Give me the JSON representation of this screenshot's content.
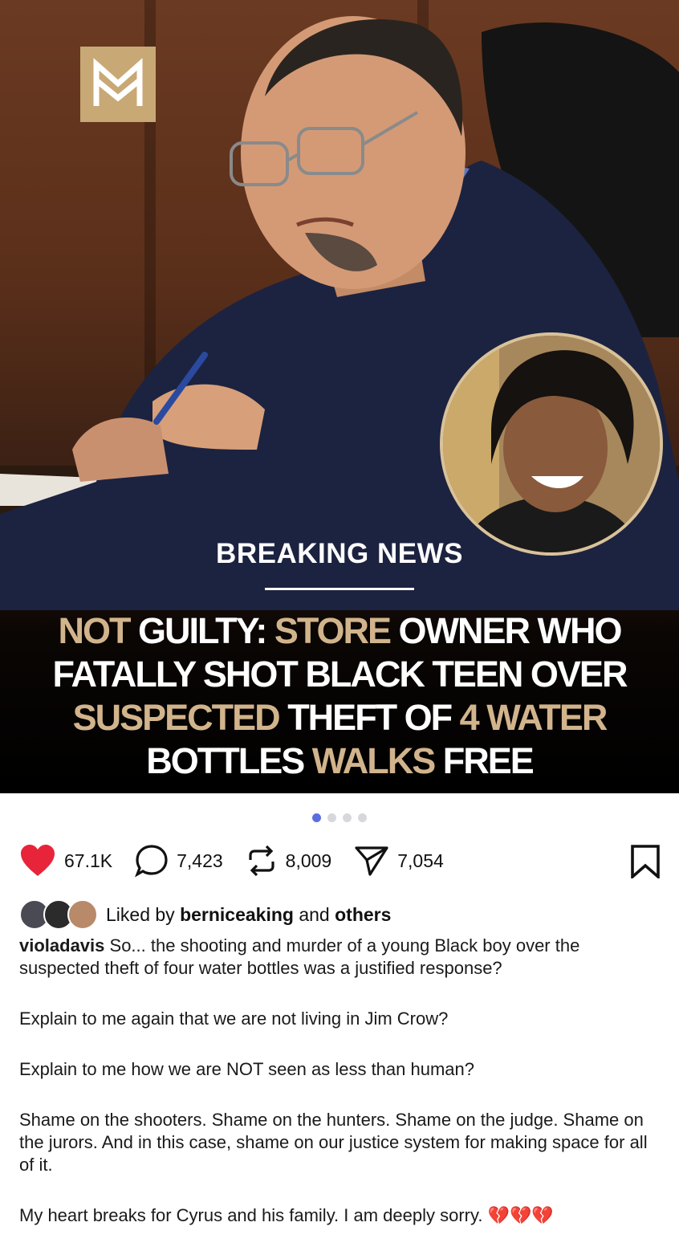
{
  "post": {
    "logo_letter": "M",
    "breaking_label": "BREAKING NEWS",
    "headline": [
      {
        "text": "NOT",
        "gold": true
      },
      {
        "text": " GUILTY: ",
        "gold": false
      },
      {
        "text": "STORE",
        "gold": true
      },
      {
        "text": " OWNER WHO FATALLY SHOT BLACK TEEN OVER ",
        "gold": false
      },
      {
        "text": "SUSPECTED",
        "gold": true
      },
      {
        "text": " THEFT OF ",
        "gold": false
      },
      {
        "text": "4 WATER",
        "gold": true
      },
      {
        "text": " BOTTLES ",
        "gold": false
      },
      {
        "text": "WALKS",
        "gold": true
      },
      {
        "text": " FREE",
        "gold": false
      }
    ],
    "carousel": {
      "total": 4,
      "active_index": 0
    }
  },
  "actions": {
    "likes": "67.1K",
    "comments": "7,423",
    "reposts": "8,009",
    "shares": "7,054",
    "icons": [
      "heart-icon",
      "comment-icon",
      "repost-icon",
      "share-icon",
      "bookmark-icon"
    ]
  },
  "liked_by": {
    "prefix": "Liked by",
    "user": "berniceaking",
    "conjunction": "and",
    "others": "others"
  },
  "caption": {
    "username": "violadavis",
    "paragraphs": [
      "So... the shooting and murder of a young Black boy over the suspected theft of four water bottles was a justified response?",
      "Explain to me again that we are not living in Jim Crow?",
      "Explain to me how we are NOT seen as less than human?",
      "Shame on the shooters. Shame on the hunters. Shame on the judge. Shame on the jurors. And in this case, shame on our justice system for making space for all of it.",
      "My heart breaks for Cyrus and his family. I am deeply sorry. 💔💔💔"
    ]
  },
  "colors": {
    "accent_gold": "#d2b48c",
    "like_red": "#e8243a",
    "carousel_active": "#5b6ee0"
  }
}
